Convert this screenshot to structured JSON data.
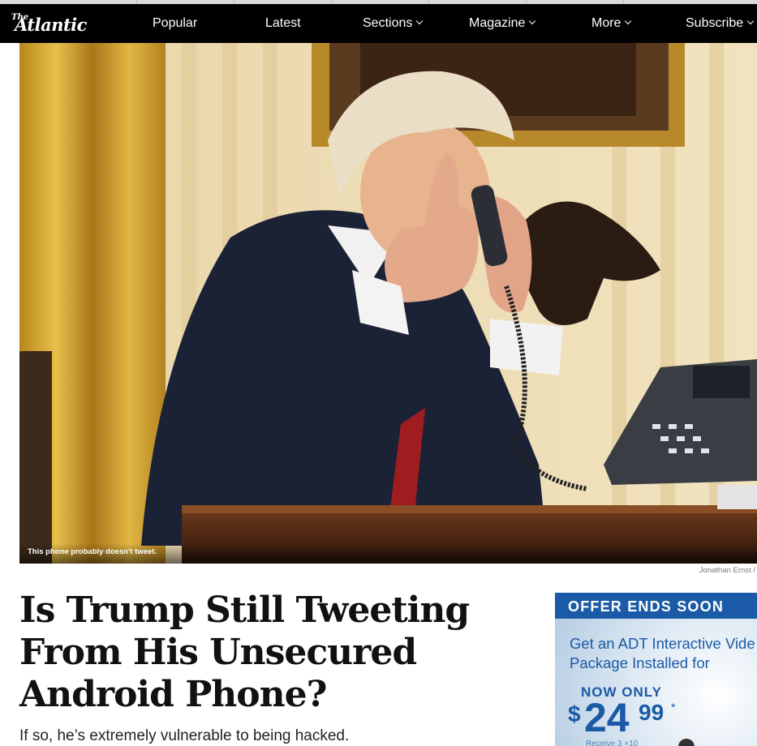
{
  "nav": {
    "logo_the": "The",
    "logo_word": "Atlantic",
    "items": [
      {
        "label": "Popular",
        "has_dropdown": false
      },
      {
        "label": "Latest",
        "has_dropdown": false
      },
      {
        "label": "Sections",
        "has_dropdown": true
      },
      {
        "label": "Magazine",
        "has_dropdown": true
      },
      {
        "label": "More",
        "has_dropdown": true
      },
      {
        "label": "Subscribe",
        "has_dropdown": true
      }
    ]
  },
  "hero": {
    "caption": "This phone probably doesn't tweet.",
    "credit": "Jonathan Ernst /"
  },
  "article": {
    "headline": "Is Trump Still Tweeting From His Unsecured Android Phone?",
    "dek": "If so, he’s extremely vulnerable to being hacked."
  },
  "ad": {
    "banner": "OFFER ENDS SOON",
    "line1": "Get an ADT Interactive Vide",
    "line2": "Package Installed for",
    "now_only": "NOW ONLY",
    "dollar": "$",
    "price_int": "24",
    "price_cents": "99",
    "asterisk": "*",
    "footnote": "Receive 3 ×10",
    "accent_color": "#1a5aa6"
  },
  "colors": {
    "nav_bg": "#000000",
    "headline": "#111111"
  }
}
